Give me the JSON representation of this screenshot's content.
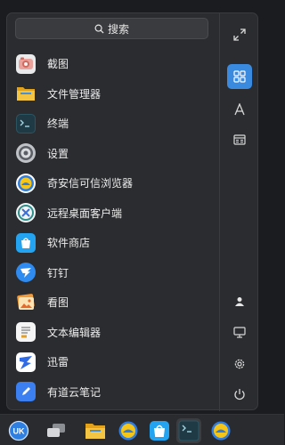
{
  "search": {
    "label": "搜索",
    "icon": "search-icon"
  },
  "apps": [
    {
      "label": "截图",
      "icon": "screenshot-icon"
    },
    {
      "label": "文件管理器",
      "icon": "file-manager-icon"
    },
    {
      "label": "终端",
      "icon": "terminal-icon"
    },
    {
      "label": "设置",
      "icon": "settings-icon"
    },
    {
      "label": "奇安信可信浏览器",
      "icon": "qianxin-browser-icon"
    },
    {
      "label": "远程桌面客户端",
      "icon": "remote-desktop-icon"
    },
    {
      "label": "软件商店",
      "icon": "software-store-icon"
    },
    {
      "label": "钉钉",
      "icon": "dingtalk-icon"
    },
    {
      "label": "看图",
      "icon": "image-viewer-icon"
    },
    {
      "label": "文本编辑器",
      "icon": "text-editor-icon"
    },
    {
      "label": "迅雷",
      "icon": "thunder-icon"
    },
    {
      "label": "有道云笔记",
      "icon": "youdao-note-icon"
    }
  ],
  "sidebar": {
    "top": [
      "expand-icon",
      "all-apps-icon",
      "letter-sort-icon",
      "category-icon"
    ],
    "bottom": [
      "user-icon",
      "computer-icon",
      "settings-icon",
      "power-icon"
    ],
    "active_index": 1,
    "accent": "#3a8ae0"
  },
  "taskbar": [
    "start-menu-icon",
    "multitask-view-icon",
    "file-manager-icon",
    "browser-icon",
    "software-store-icon",
    "terminal-icon",
    "browser-icon"
  ]
}
